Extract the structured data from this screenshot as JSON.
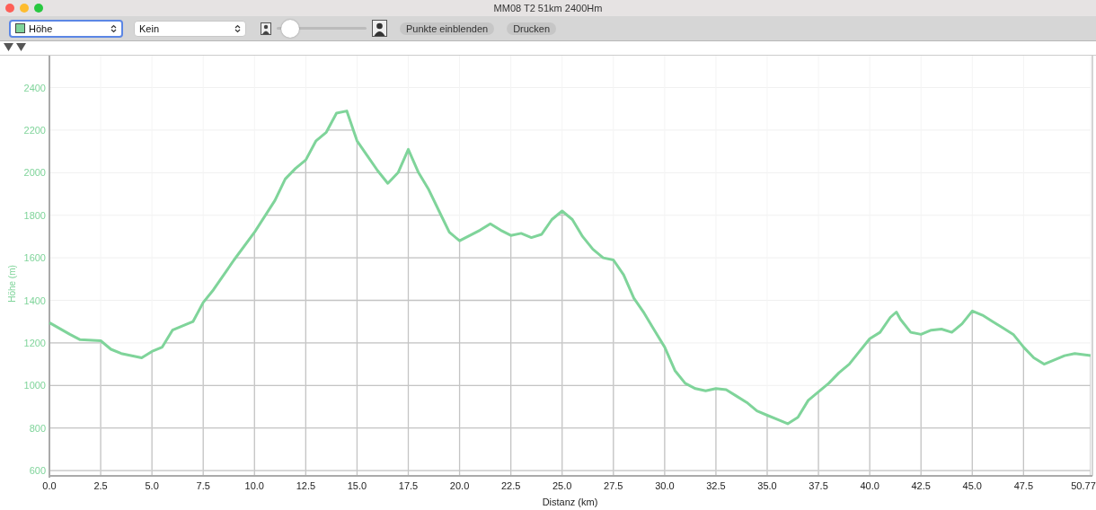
{
  "window": {
    "title": "MM08 T2 51km 2400Hm"
  },
  "toolbar": {
    "series_select": {
      "value": "Höhe",
      "focused": true,
      "color": "#7fd49a"
    },
    "compare_select": {
      "value": "Kein",
      "focused": false
    },
    "zoom_slider": {
      "level": 0.05
    },
    "buttons": [
      "Punkte einblenden",
      "Drucken"
    ]
  },
  "chart": {
    "chart_data": {
      "type": "line",
      "grid": true,
      "xlabel": "Distanz (km)",
      "ylabel": "Höhe (m)",
      "xlim": [
        0,
        50.77
      ],
      "ylim": [
        575,
        2550
      ],
      "x": [
        0,
        1,
        1.5,
        2.5,
        3,
        3.5,
        4.5,
        5,
        5.5,
        6,
        7,
        7.5,
        8,
        9,
        10,
        11,
        11.5,
        12,
        12.5,
        13,
        13.5,
        14,
        14.5,
        15,
        15.5,
        16,
        16.5,
        17,
        17.5,
        18,
        18.5,
        19,
        19.5,
        20,
        21,
        21.5,
        22,
        22.5,
        23,
        23.5,
        24,
        24.5,
        25,
        25.5,
        26,
        26.5,
        27,
        27.5,
        28,
        28.5,
        29,
        29.5,
        30,
        30.5,
        31,
        31.5,
        32,
        32.5,
        33,
        33.5,
        34,
        34.5,
        35,
        35.5,
        36,
        36.5,
        37,
        37.5,
        38,
        38.5,
        39,
        39.5,
        40,
        40.5,
        41,
        41.3,
        41.5,
        42,
        42.5,
        43,
        43.5,
        44,
        44.5,
        45,
        45.5,
        46,
        46.5,
        47,
        47.5,
        48,
        48.5,
        49,
        49.5,
        50,
        50.77
      ],
      "series": [
        {
          "color": "#7fd49a",
          "values": [
            1295,
            1240,
            1215,
            1210,
            1170,
            1150,
            1130,
            1160,
            1180,
            1260,
            1300,
            1390,
            1450,
            1590,
            1720,
            1870,
            1970,
            2020,
            2060,
            2150,
            2190,
            2280,
            2290,
            2150,
            2080,
            2010,
            1950,
            2000,
            2110,
            2000,
            1920,
            1820,
            1720,
            1680,
            1730,
            1760,
            1730,
            1705,
            1715,
            1695,
            1710,
            1780,
            1820,
            1780,
            1700,
            1640,
            1600,
            1590,
            1520,
            1410,
            1340,
            1260,
            1180,
            1070,
            1010,
            985,
            975,
            985,
            980,
            950,
            920,
            880,
            860,
            840,
            820,
            850,
            930,
            970,
            1010,
            1060,
            1100,
            1160,
            1220,
            1250,
            1320,
            1345,
            1310,
            1250,
            1240,
            1260,
            1265,
            1250,
            1290,
            1350,
            1330,
            1300,
            1270,
            1240,
            1180,
            1130,
            1100,
            1120,
            1140,
            1150,
            1140
          ]
        }
      ],
      "xticks": [
        {
          "value": 0,
          "label": "0.0"
        },
        {
          "value": 2.5,
          "label": "2.5"
        },
        {
          "value": 5,
          "label": "5.0"
        },
        {
          "value": 7.5,
          "label": "7.5"
        },
        {
          "value": 10,
          "label": "10.0"
        },
        {
          "value": 12.5,
          "label": "12.5"
        },
        {
          "value": 15,
          "label": "15.0"
        },
        {
          "value": 17.5,
          "label": "17.5"
        },
        {
          "value": 20,
          "label": "20.0"
        },
        {
          "value": 22.5,
          "label": "22.5"
        },
        {
          "value": 25,
          "label": "25.0"
        },
        {
          "value": 27.5,
          "label": "27.5"
        },
        {
          "value": 30,
          "label": "30.0"
        },
        {
          "value": 32.5,
          "label": "32.5"
        },
        {
          "value": 35,
          "label": "35.0"
        },
        {
          "value": 37.5,
          "label": "37.5"
        },
        {
          "value": 40,
          "label": "40.0"
        },
        {
          "value": 42.5,
          "label": "42.5"
        },
        {
          "value": 45,
          "label": "45.0"
        },
        {
          "value": 47.5,
          "label": "47.5"
        },
        {
          "value": 50.77,
          "label": "50.77"
        }
      ],
      "yticks": [
        600,
        800,
        1000,
        1200,
        1400,
        1600,
        1800,
        2000,
        2200,
        2400
      ]
    }
  }
}
